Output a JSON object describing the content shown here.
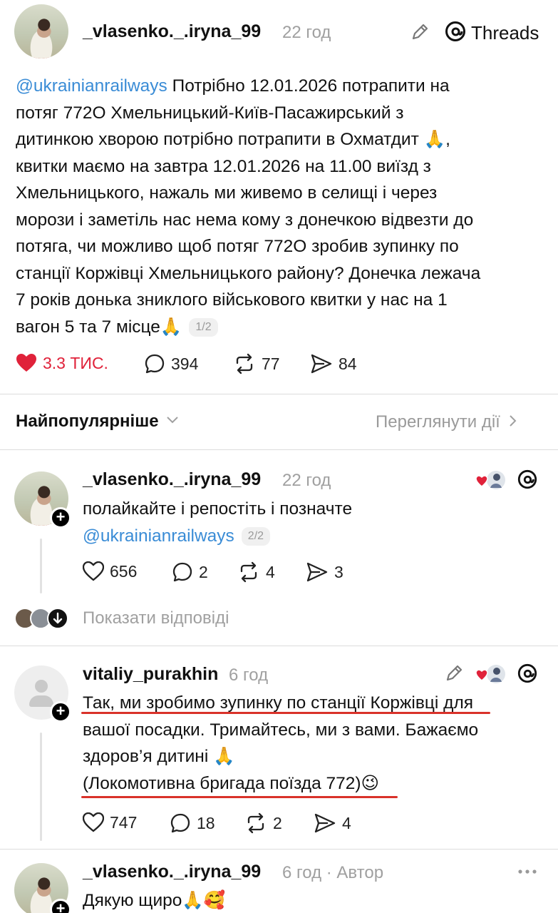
{
  "colors": {
    "mention": "#3a8cd6",
    "liked": "#e0223a",
    "underline": "#d9322a",
    "muted": "#a0a0a0"
  },
  "main_post": {
    "username": "_vlasenko._.iryna_99",
    "time": "22 год",
    "brand": "Threads",
    "mention": "@ukrainianrailways",
    "text_lines": [
      "Потрібно 12.01.2026 потрапити на",
      "потяг 772О Хмельницький-Київ-Пасажирський з",
      "дитинкою хворою потрібно потрапити в Охматдит 🙏,",
      "квитки маємо на завтра 12.01.2026 на 11.00 виїзд з",
      "Хмельницького, нажаль ми живемо в селищі і через",
      "морози і заметіль нас нема кому з донечкою відвезти до",
      "потяга, чи можливо щоб потяг 772О зробив зупинку по",
      "станції Коржівці Хмельницького району? Донечка лежача",
      "7 років донька зниклого військового квитки у нас на 1",
      "вагон 5 та 7 місце🙏"
    ],
    "page": "1/2",
    "likes": "3.3 ТИС.",
    "comments": "394",
    "reposts": "77",
    "shares": "84"
  },
  "sort": {
    "label": "Найпопулярніше",
    "view_actions": "Переглянути дії"
  },
  "replies": [
    {
      "username": "_vlasenko._.iryna_99",
      "time": "22 год",
      "line1": "полайкайте і репостіть і позначте",
      "mention": "@ukrainianrailways",
      "page": "2/2",
      "likes": "656",
      "comments": "2",
      "reposts": "4",
      "shares": "3",
      "show_replies": "Показати відповіді"
    },
    {
      "username": "vitaliy_purakhin",
      "time": "6 год",
      "lines": [
        "Так, ми зробимо зупинку по станції Коржівці для",
        "вашої посадки. Тримайтесь, ми з вами. Бажаємо",
        "здоров’я дитині 🙏",
        "(Локомотивна бригада поїзда 772)😉"
      ],
      "likes": "747",
      "comments": "18",
      "reposts": "2",
      "shares": "4"
    },
    {
      "username": "_vlasenko._.iryna_99",
      "time": "6 год · Автор",
      "text": "Дякую щиро🙏🥰"
    }
  ]
}
